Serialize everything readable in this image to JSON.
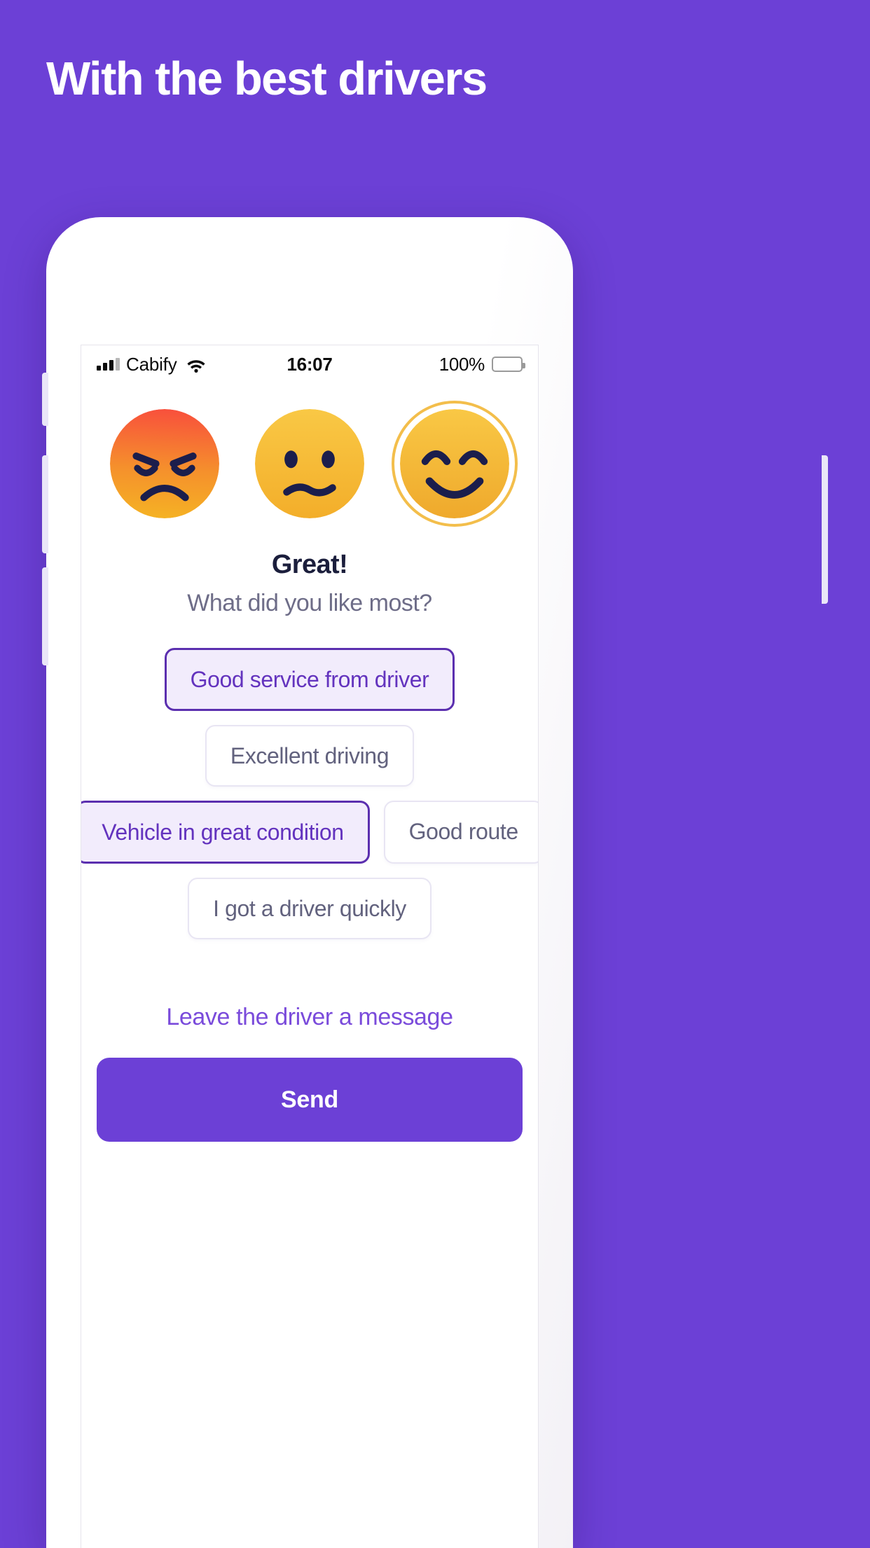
{
  "promo": {
    "headline": "With the best drivers",
    "background_color": "#6C40D6"
  },
  "status_bar": {
    "carrier": "Cabify",
    "signal_icon": "signal-bars-icon",
    "wifi_icon": "wifi-icon",
    "time": "16:07",
    "battery_percent": "100%",
    "battery_icon": "battery-full-icon"
  },
  "rating": {
    "faces": [
      {
        "name": "angry-face",
        "label": "Bad",
        "selected": false,
        "color_from": "#F8503C",
        "color_to": "#F5A623"
      },
      {
        "name": "neutral-face",
        "label": "Okay",
        "selected": false,
        "color_from": "#F8C640",
        "color_to": "#F5B731"
      },
      {
        "name": "happy-face",
        "label": "Great",
        "selected": true,
        "color_from": "#F8C640",
        "color_to": "#EFA92C"
      }
    ],
    "selected_index": 2,
    "selection_ring_color": "#F3BE4B"
  },
  "feedback": {
    "title": "Great!",
    "subtitle": "What did you like most?",
    "chip_rows": [
      [
        {
          "label": "Good service from driver",
          "selected": true
        }
      ],
      [
        {
          "label": "Excellent driving",
          "selected": false
        }
      ],
      [
        {
          "label": "Vehicle in great condition",
          "selected": true
        },
        {
          "label": "Good route",
          "selected": false
        }
      ],
      [
        {
          "label": "I got a driver quickly",
          "selected": false
        }
      ]
    ]
  },
  "footer": {
    "message_link": "Leave the driver a message",
    "send_label": "Send",
    "send_color": "#6C40D6",
    "link_color": "#7A4BDB"
  }
}
